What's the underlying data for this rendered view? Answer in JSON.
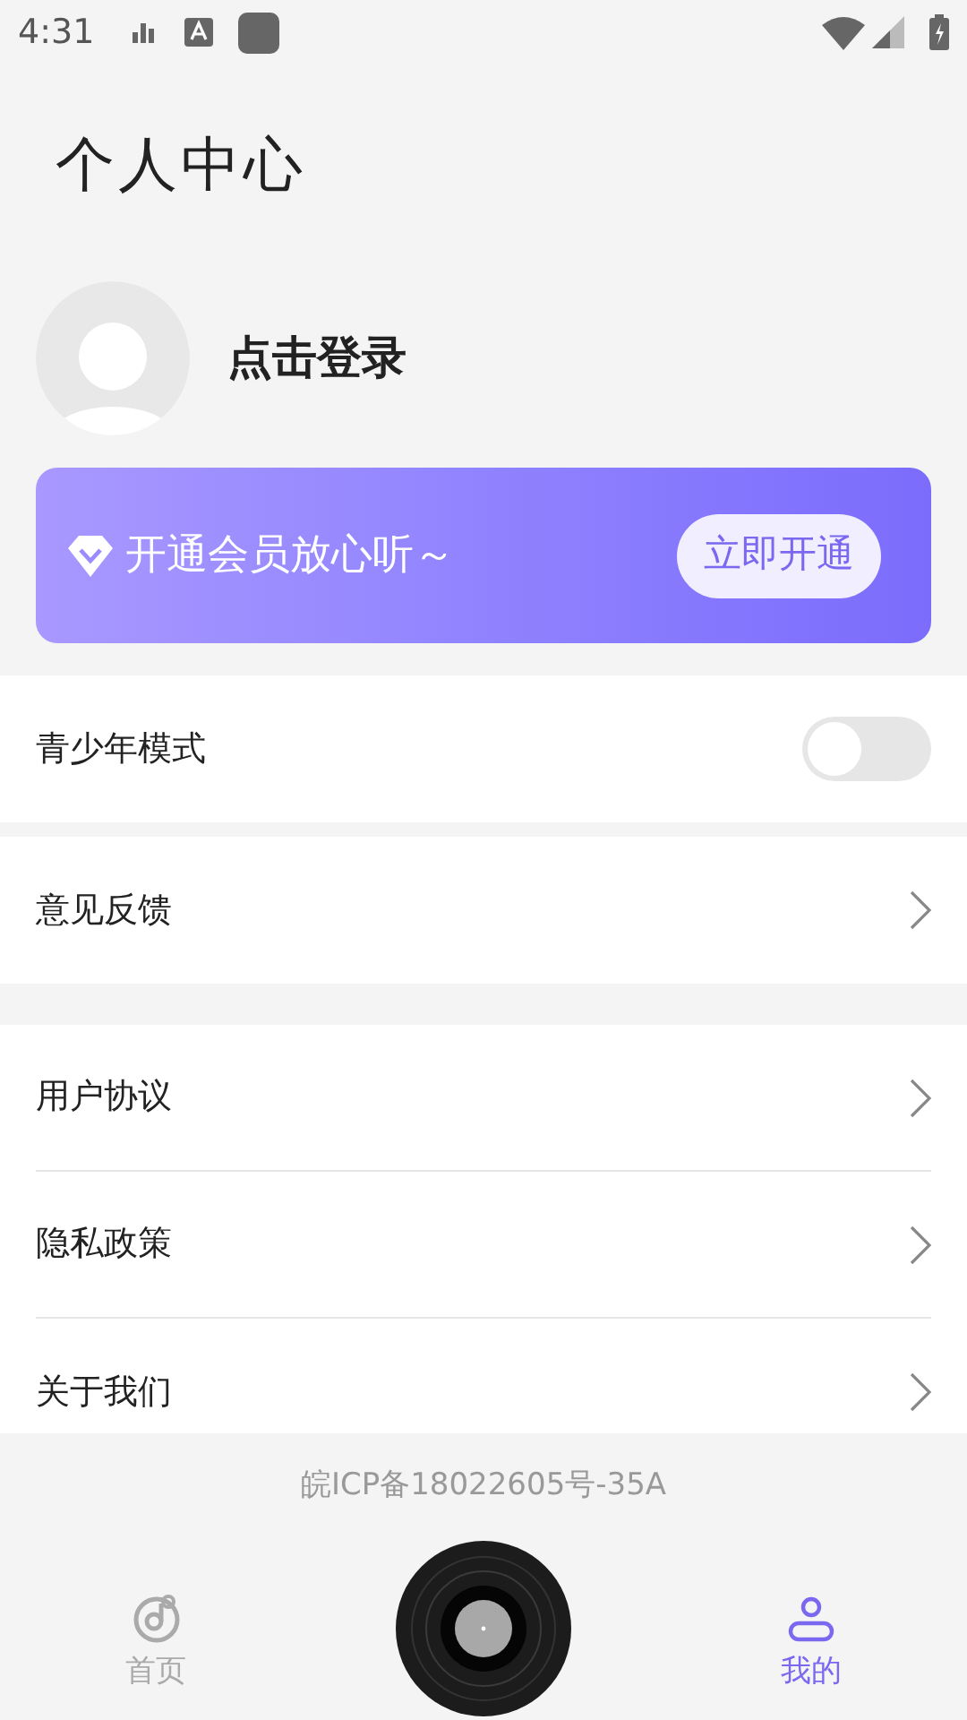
{
  "status_bar": {
    "time": "4:31"
  },
  "header": {
    "title": "个人中心"
  },
  "profile": {
    "login_label": "点击登录"
  },
  "vip_banner": {
    "text": "开通会员放心听～",
    "button": "立即开通"
  },
  "menu_groups": [
    [
      {
        "kind": "toggle",
        "label": "青少年模式",
        "on": false
      }
    ],
    [
      {
        "kind": "link",
        "label": "意见反馈"
      }
    ],
    [
      {
        "kind": "link",
        "label": "用户协议"
      },
      {
        "kind": "link",
        "label": "隐私政策"
      },
      {
        "kind": "link",
        "label": "关于我们"
      }
    ]
  ],
  "footer": {
    "icp": "皖ICP备18022605号-35A"
  },
  "tab_bar": [
    {
      "kind": "home",
      "label": "首页",
      "selected": false
    },
    {
      "kind": "player"
    },
    {
      "kind": "me",
      "label": "我的",
      "selected": true
    }
  ]
}
